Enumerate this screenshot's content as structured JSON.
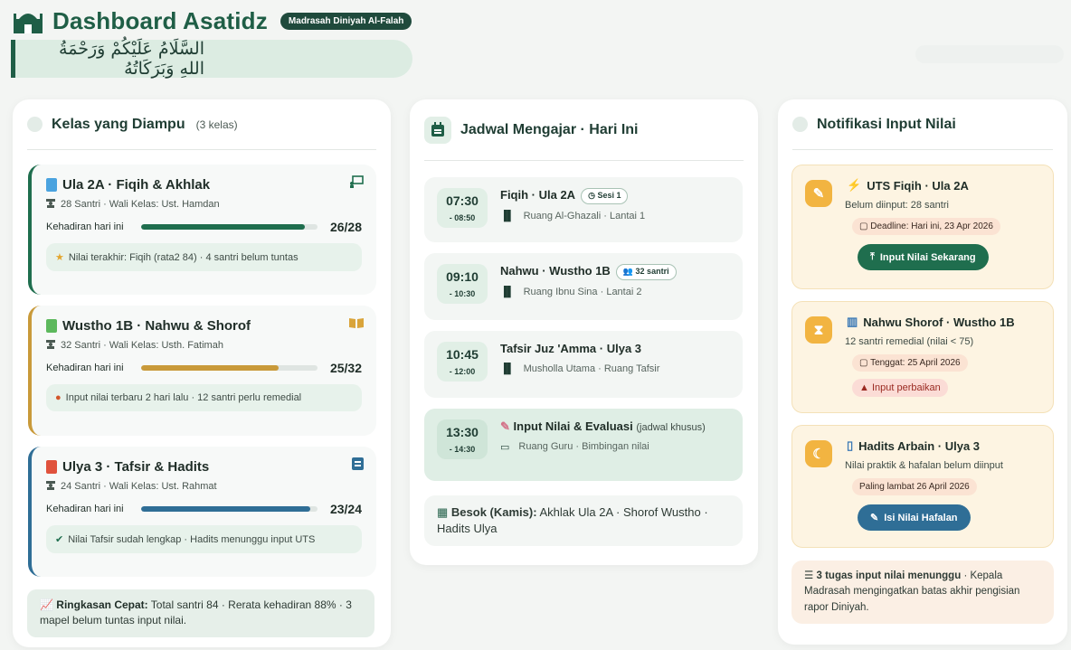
{
  "header": {
    "title": "Dashboard Asatidz",
    "badge": "Madrasah Diniyah Al-Falah",
    "salam": "السَّلَامُ عَلَيْكُمْ وَرَحْمَةُ اللهِ وَبَرَكَاتُهُ"
  },
  "kelas": {
    "title": "Kelas yang Diampu",
    "count": "(3 kelas)",
    "items": [
      {
        "name": "Ula 2A · Fiqih & Akhlak",
        "info": "28 Santri · Wali Kelas: Ust. Hamdan",
        "hadir_label": "Kehadiran hari ini",
        "hadir_value": "26/28",
        "hadir_pct": 0.93,
        "color": "#1f6e4e",
        "book_color": "#4aa3df",
        "note": "Nilai terakhir: Fiqih (rata2 84) · 4 santri belum tuntas",
        "note_icon": "star-icon"
      },
      {
        "name": "Wustho 1B · Nahwu & Shorof",
        "info": "32 Santri · Wali Kelas: Usth. Fatimah",
        "hadir_label": "Kehadiran hari ini",
        "hadir_value": "25/32",
        "hadir_pct": 0.78,
        "color": "#c99a3a",
        "book_color": "#5cb85c",
        "note": "Input nilai terbaru 2 hari lalu · 12 santri perlu remedial",
        "note_icon": "alert-icon"
      },
      {
        "name": "Ulya 3 · Tafsir & Hadits",
        "info": "24 Santri · Wali Kelas: Ust. Rahmat",
        "hadir_label": "Kehadiran hari ini",
        "hadir_value": "23/24",
        "hadir_pct": 0.96,
        "color": "#2f6e96",
        "book_color": "#e0523c",
        "note": "Nilai Tafsir sudah lengkap · Hadits menunggu input UTS",
        "note_icon": "check-icon"
      }
    ],
    "ringkasan_label": "Ringkasan Cepat:",
    "ringkasan_text": "Total santri 84 · Rerata kehadiran 88% · 3 mapel belum tuntas input nilai."
  },
  "jadwal": {
    "title": "Jadwal Mengajar · Hari Ini",
    "items": [
      {
        "start": "07:30",
        "end": "- 08:50",
        "title": "Fiqih · Ula 2A",
        "pill": "Sesi 1",
        "room": "Ruang Al-Ghazali · Lantai 1"
      },
      {
        "start": "09:10",
        "end": "- 10:30",
        "title": "Nahwu · Wustho 1B",
        "pill": "32 santri",
        "room": "Ruang Ibnu Sina · Lantai 2"
      },
      {
        "start": "10:45",
        "end": "- 12:00",
        "title": "Tafsir Juz 'Amma · Ulya 3",
        "pill": "",
        "room": "Musholla Utama · Ruang Tafsir"
      },
      {
        "start": "13:30",
        "end": "- 14:30",
        "title": "Input Nilai & Evaluasi",
        "title_suffix": "(jadwal khusus)",
        "pill": "",
        "room": "Ruang Guru · Bimbingan nilai"
      }
    ],
    "besok_label": "Besok (Kamis):",
    "besok_text": "Akhlak Ula 2A · Shorof Wustho · Hadits Ulya"
  },
  "notifikasi": {
    "title": "Notifikasi Input Nilai",
    "items": [
      {
        "title": "UTS Fiqih · Ula 2A",
        "desc": "Belum diinput: 28 santri",
        "deadline": "Deadline: Hari ini, 23 Apr 2026",
        "button": "Input Nilai Sekarang"
      },
      {
        "title": "Nahwu Shorof · Wustho 1B",
        "desc": "12 santri remedial (nilai < 75)",
        "deadline": "Tenggat: 25 April 2026",
        "chip": "Input perbaikan"
      },
      {
        "title": "Hadits Arbain · Ulya 3",
        "desc": "Nilai praktik & hafalan belum diinput",
        "deadline": "Paling lambat 26 April 2026",
        "button": "Isi Nilai Hafalan"
      }
    ],
    "tugas_label": "3 tugas input nilai menunggu",
    "tugas_text": " · Kepala Madrasah mengingatkan batas akhir pengisian rapor Diniyah."
  }
}
